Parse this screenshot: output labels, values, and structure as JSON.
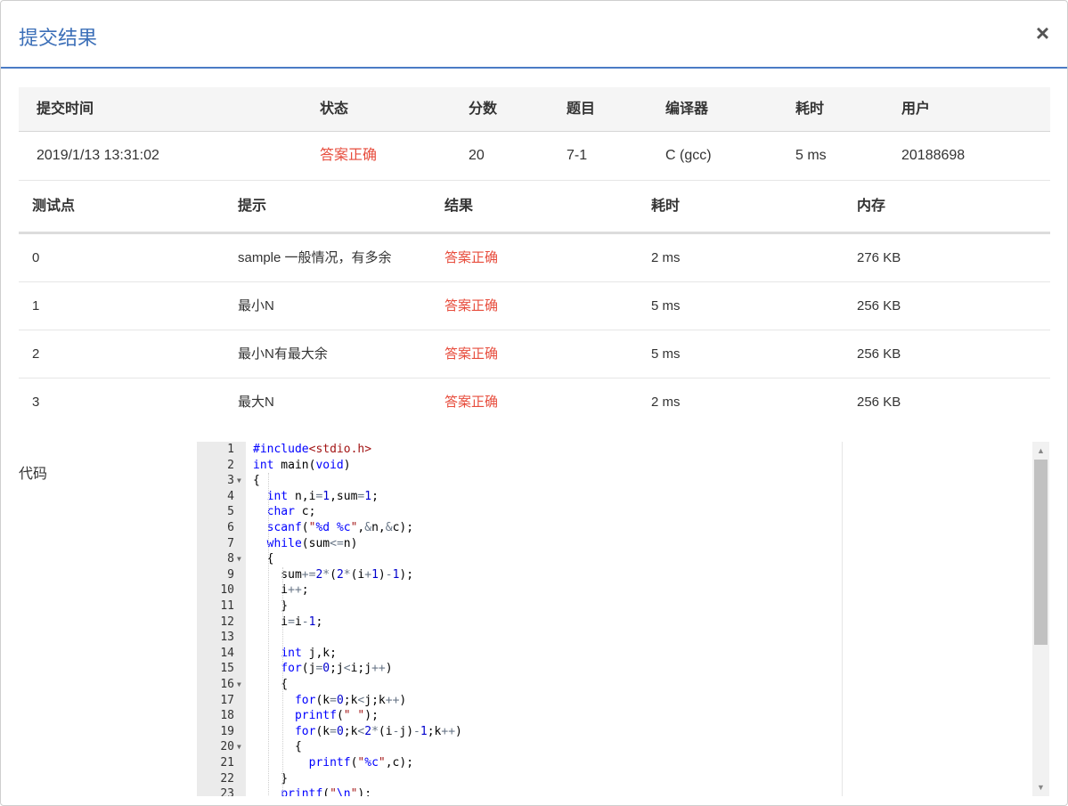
{
  "modal": {
    "title": "提交结果",
    "close_label": "×"
  },
  "summary": {
    "headers": [
      "提交时间",
      "状态",
      "分数",
      "题目",
      "编译器",
      "耗时",
      "用户"
    ],
    "row": [
      "2019/1/13 13:31:02",
      "答案正确",
      "20",
      "7-1",
      "C (gcc)",
      "5 ms",
      "20188698"
    ]
  },
  "cases": {
    "headers": [
      "测试点",
      "提示",
      "结果",
      "耗时",
      "内存"
    ],
    "rows": [
      [
        "0",
        "sample 一般情况，有多余",
        "答案正确",
        "2 ms",
        "276 KB"
      ],
      [
        "1",
        "最小N",
        "答案正确",
        "5 ms",
        "256 KB"
      ],
      [
        "2",
        "最小N有最大余",
        "答案正确",
        "5 ms",
        "256 KB"
      ],
      [
        "3",
        "最大N",
        "答案正确",
        "2 ms",
        "256 KB"
      ]
    ]
  },
  "code": {
    "label": "代码",
    "lines": [
      "#include<stdio.h>",
      "int main(void)",
      "{",
      "  int n,i=1,sum=1;",
      "  char c;",
      "  scanf(\"%d %c\",&n,&c);",
      "  while(sum<=n)",
      "  {",
      "    sum+=2*(2*(i+1)-1);",
      "    i++;",
      "    }",
      "    i=i-1;",
      "",
      "    int j,k;",
      "    for(j=0;j<i;j++)",
      "    {",
      "      for(k=0;k<j;k++)",
      "      printf(\" \");",
      "      for(k=0;k<2*(i-j)-1;k++)",
      "      {",
      "        printf(\"%c\",c);",
      "    }",
      "    printf(\"\\n\");"
    ],
    "fold_lines": [
      3,
      8,
      16,
      20
    ]
  },
  "colors": {
    "accent": "#3c6fb8",
    "ok": "#e74c3c"
  }
}
